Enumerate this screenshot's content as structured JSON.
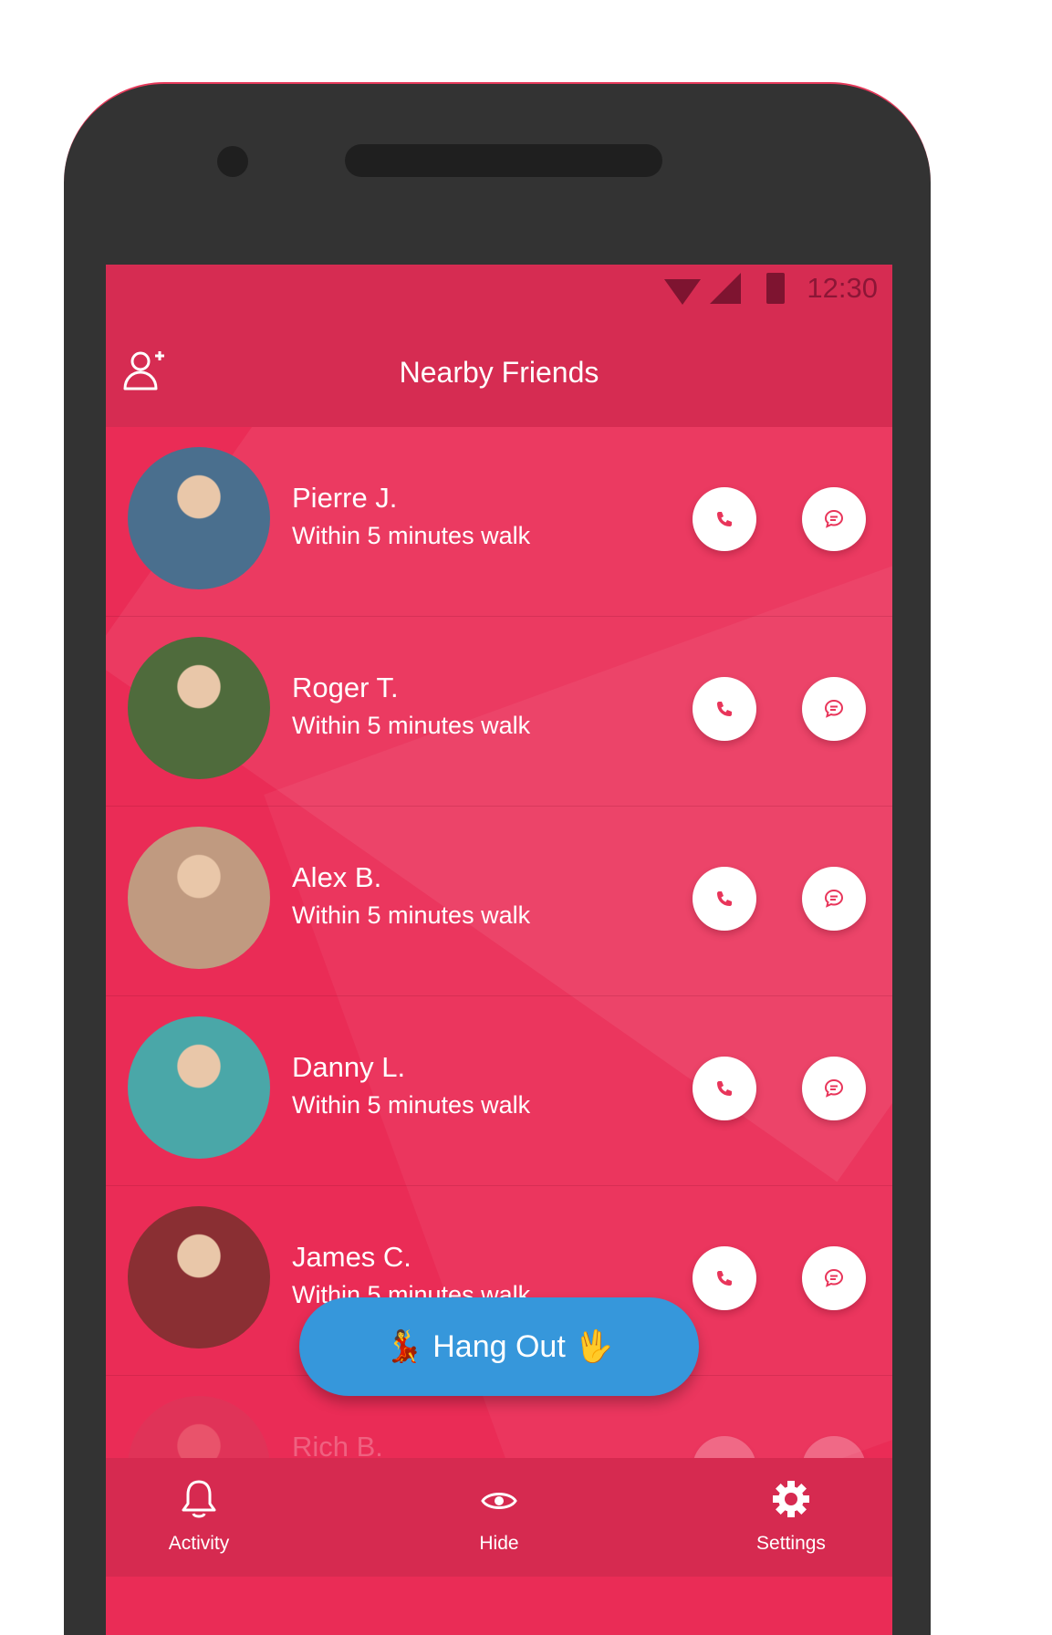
{
  "status_bar": {
    "time": "12:30"
  },
  "app_bar": {
    "title": "Nearby Friends",
    "add_friend_icon": "add-person-icon"
  },
  "friends": [
    {
      "name": "Pierre J.",
      "distance": "Within 5 minutes walk",
      "avatar_color": "#4a6f8e"
    },
    {
      "name": "Roger T.",
      "distance": "Within 5 minutes walk",
      "avatar_color": "#4f6b3c"
    },
    {
      "name": "Alex B.",
      "distance": "Within 5 minutes walk",
      "avatar_color": "#c09a80"
    },
    {
      "name": "Danny L.",
      "distance": "Within 5 minutes walk",
      "avatar_color": "#4aa7a8"
    },
    {
      "name": "James C.",
      "distance": "Within 5 minutes walk",
      "avatar_color": "#8a2f33"
    },
    {
      "name": "Rich B.",
      "distance": "",
      "avatar_color": "#c44a5f"
    }
  ],
  "fab": {
    "label": "Hang Out",
    "left_emoji": "💃",
    "right_emoji": "🖖"
  },
  "bottom_nav": [
    {
      "label": "Activity",
      "icon": "bell-icon"
    },
    {
      "label": "Hide",
      "icon": "eye-icon"
    },
    {
      "label": "Settings",
      "icon": "gear-icon"
    }
  ],
  "colors": {
    "primary": "#ea2c56",
    "primary_dark": "#d62c52",
    "fab": "#3697db",
    "device": "#333333"
  }
}
